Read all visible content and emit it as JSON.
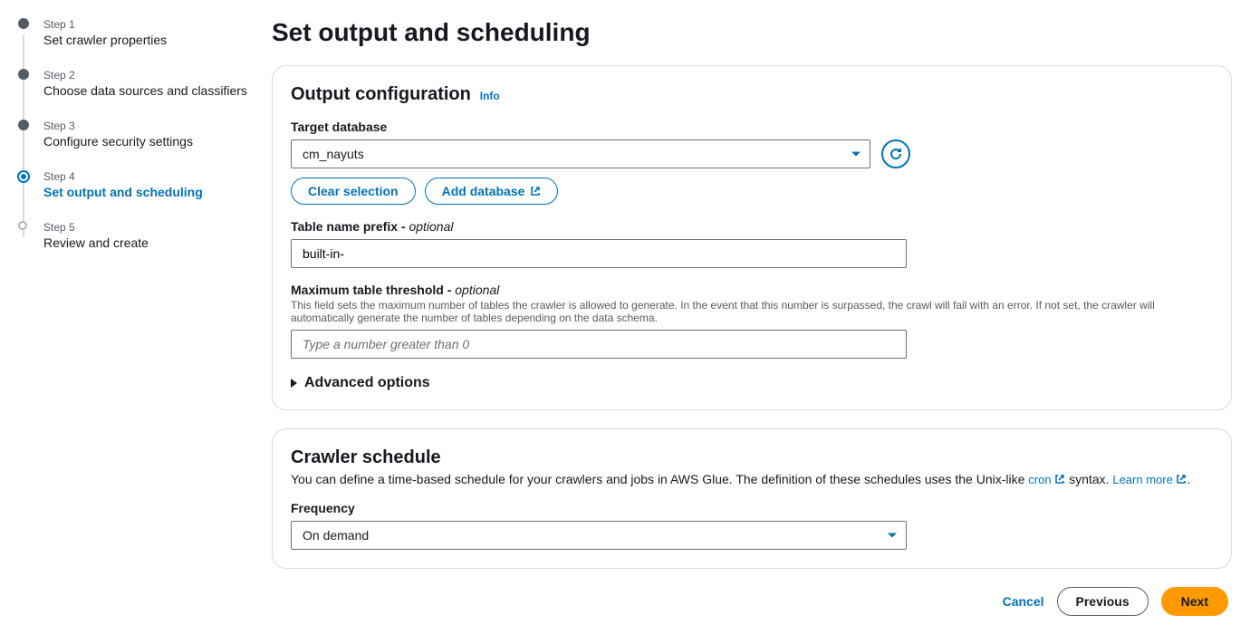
{
  "stepper": [
    {
      "label": "Step 1",
      "title": "Set crawler properties"
    },
    {
      "label": "Step 2",
      "title": "Choose data sources and classifiers"
    },
    {
      "label": "Step 3",
      "title": "Configure security settings"
    },
    {
      "label": "Step 4",
      "title": "Set output and scheduling"
    },
    {
      "label": "Step 5",
      "title": "Review and create"
    }
  ],
  "page_title": "Set output and scheduling",
  "output": {
    "section_title": "Output configuration",
    "info": "Info",
    "target_db_label": "Target database",
    "target_db_value": "cm_nayuts",
    "clear_selection": "Clear selection",
    "add_database": "Add database",
    "prefix_label": "Table name prefix - ",
    "prefix_optional": "optional",
    "prefix_value": "built-in-",
    "threshold_label": "Maximum table threshold - ",
    "threshold_optional": "optional",
    "threshold_desc": "This field sets the maximum number of tables the crawler is allowed to generate. In the event that this number is surpassed, the crawl will fail with an error. If not set, the crawler will automatically generate the number of tables depending on the data schema.",
    "threshold_placeholder": "Type a number greater than 0",
    "advanced": "Advanced options"
  },
  "schedule": {
    "section_title": "Crawler schedule",
    "desc_a": "You can define a time-based schedule for your crawlers and jobs in AWS Glue. The definition of these schedules uses the Unix-like ",
    "cron_link": "cron",
    "desc_b": " syntax. ",
    "learn_more": "Learn more",
    "period": ".",
    "frequency_label": "Frequency",
    "frequency_value": "On demand"
  },
  "footer": {
    "cancel": "Cancel",
    "previous": "Previous",
    "next": "Next"
  }
}
